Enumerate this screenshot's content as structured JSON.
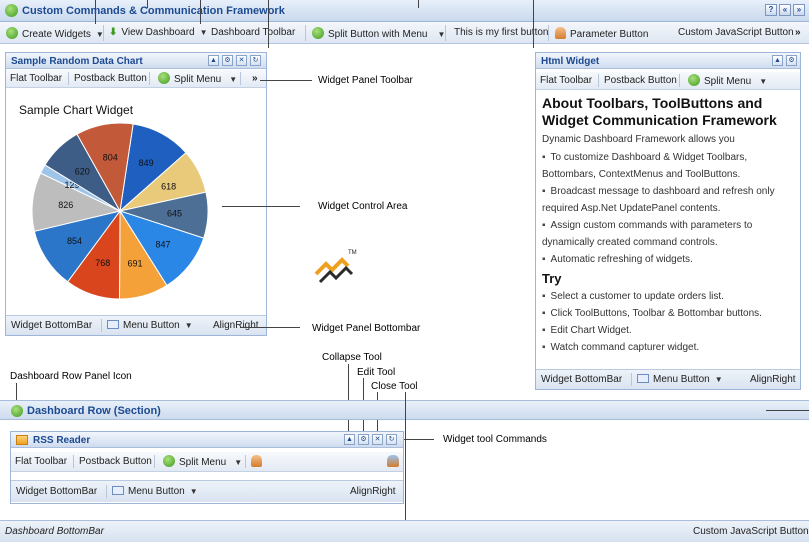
{
  "app": {
    "title": "Custom Commands & Communication Framework",
    "sys_buttons": [
      "?",
      "«",
      "»"
    ]
  },
  "toolbar": {
    "create_widgets": "Create Widgets",
    "view_dashboard": "View Dashboard",
    "dashboard_toolbar": "Dashboard Toolbar",
    "split_button": "Split Button with Menu",
    "first_button": "This is my first button",
    "parameter_button": "Parameter Button",
    "custom_js_button": "Custom JavaScript Button",
    "overflow": "»"
  },
  "chart_widget": {
    "title": "Sample Random Data Chart",
    "toolbar": {
      "flat": "Flat Toolbar",
      "postback": "Postback Button",
      "split": "Split Menu",
      "more": "»"
    },
    "bottombar": {
      "label": "Widget BottomBar",
      "menu": "Menu Button",
      "align": "AlignRight"
    }
  },
  "chart_data": {
    "type": "pie",
    "title": "Sample Chart Widget",
    "values": [
      849,
      618,
      645,
      847,
      691,
      768,
      854,
      826,
      129,
      620,
      804
    ],
    "colors": [
      "#1f5fc0",
      "#e9c97a",
      "#4e6f95",
      "#2b87e6",
      "#f4a13a",
      "#d9461e",
      "#2c76c9",
      "#bdbdbd",
      "#9ec4ea",
      "#3d5c86",
      "#c25a3a"
    ]
  },
  "html_widget": {
    "title": "Html Widget",
    "toolbar": {
      "flat": "Flat Toolbar",
      "postback": "Postback Button",
      "split": "Split Menu"
    },
    "heading": "About Toolbars, ToolButtons and Widget Communication Framework",
    "intro": "Dynamic Dashboard Framework allows you",
    "bullets": [
      "To customize Dashboard & Widget Toolbars, Bottombars, ContextMenus and ToolButtons.",
      "Broadcast message to dashboard and refresh only required Asp.Net UpdatePanel contents.",
      "Assign custom commands with parameters to dynamically created command controls.",
      "Automatic refreshing of widgets."
    ],
    "try_heading": "Try",
    "try_bullets": [
      "Select a customer to update orders list.",
      "Click ToolButtons, Toolbar & Bottombar buttons.",
      "Edit Chart Widget.",
      "Watch command capturer widget."
    ],
    "bottombar": {
      "label": "Widget BottomBar",
      "menu": "Menu Button",
      "align": "AlignRight"
    }
  },
  "row_panel": {
    "title": "Dashboard Row (Section)"
  },
  "rss_widget": {
    "title": "RSS Reader",
    "toolbar": {
      "flat": "Flat Toolbar",
      "postback": "Postback Button",
      "split": "Split Menu"
    },
    "bottombar": {
      "label": "Widget BottomBar",
      "menu": "Menu Button",
      "align": "AlignRight"
    }
  },
  "dashboard_bottombar": {
    "label": "Dashboard BottomBar",
    "custom_js": "Custom JavaScript Button"
  },
  "callouts": {
    "panel_toolbar": "Widget Panel Toolbar",
    "control_area": "Widget Control Area",
    "panel_bottombar": "Widget Panel Bottombar",
    "collapse_tool": "Collapse Tool",
    "edit_tool": "Edit Tool",
    "close_tool": "Close Tool",
    "row_panel_icon": "Dashboard Row Panel Icon",
    "tool_commands": "Widget tool Commands"
  },
  "logo": {
    "tm": "TM"
  }
}
